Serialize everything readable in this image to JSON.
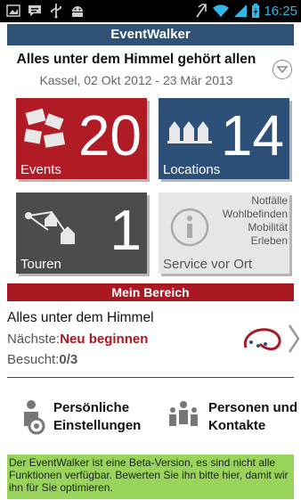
{
  "statusbar": {
    "time": "16:25",
    "left_icons": [
      "image-notification-icon",
      "chat-notification-icon",
      "usb-icon",
      "android-icon"
    ],
    "right_icons": [
      "no-sim-icon",
      "wifi-icon",
      "signal-icon",
      "battery-icon"
    ]
  },
  "app": {
    "title": "EventWalker"
  },
  "header": {
    "title": "Alles unter dem Himmel gehört allen",
    "subtitle": "Kassel, 02 Okt 2012 - 23 Mär 2013"
  },
  "tiles": {
    "events": {
      "count": "20",
      "label": "Events",
      "color": "#b01b26"
    },
    "locations": {
      "count": "14",
      "label": "Locations",
      "color": "#2c5078"
    },
    "touren": {
      "count": "1",
      "label": "Touren",
      "color": "#4c4c4c"
    },
    "service": {
      "label": "Service vor Ort",
      "lines": [
        "Notfälle",
        "Wohlbefinden",
        "Mobilität",
        "Erleben"
      ]
    }
  },
  "mein_bereich": {
    "heading": "Mein Bereich",
    "name": "Alles unter dem Himmel",
    "next_label": "Nächste:",
    "next_value": "Neu beginnen",
    "visited_label": "Besucht:",
    "visited_value": "0/3"
  },
  "actions": {
    "settings_line1": "Persönliche",
    "settings_line2": "Einstellungen",
    "contacts_line1": "Personen und",
    "contacts_line2": "Kontakte"
  },
  "beta": {
    "text": "Der EventWalker ist eine Beta-Version, es sind nicht alle Funktionen verfügbar. Bewerten Sie ihn bitte hier, damit wir ihn für Sie optimieren."
  }
}
